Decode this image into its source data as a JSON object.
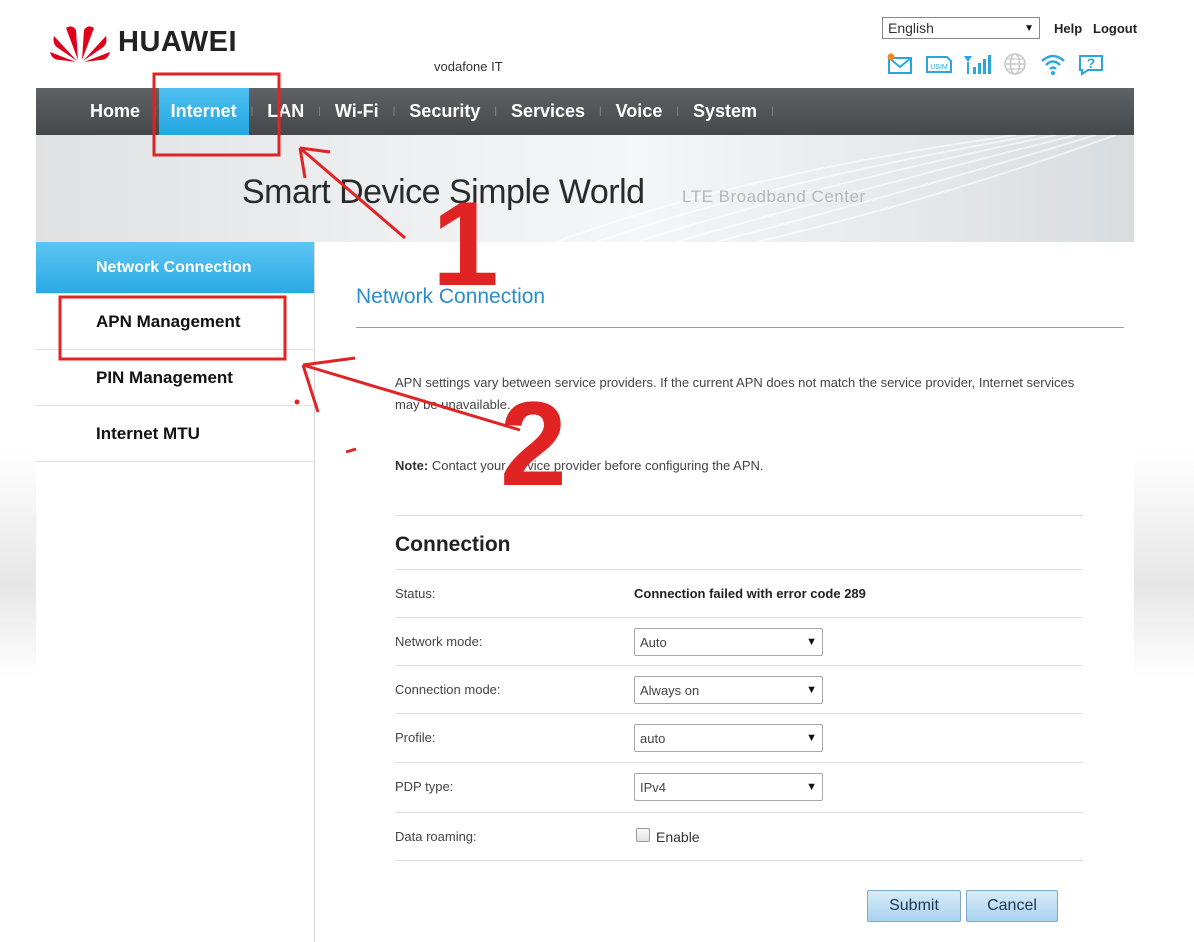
{
  "header": {
    "brand": "HUAWEI",
    "operator": "vodafone IT",
    "language": "English",
    "help": "Help",
    "logout": "Logout"
  },
  "status_icons": [
    "envelope-icon",
    "usim-icon",
    "signal-icon",
    "globe-icon",
    "wifi-icon",
    "help-icon"
  ],
  "nav": [
    "Home",
    "Internet",
    "LAN",
    "Wi-Fi",
    "Security",
    "Services",
    "Voice",
    "System"
  ],
  "nav_active": "Internet",
  "banner": {
    "slogan": "Smart Device  Simple World",
    "sub": "LTE  Broadband  Center"
  },
  "sidebar": [
    "Network Connection",
    "APN Management",
    "PIN Management",
    "Internet MTU"
  ],
  "sidebar_active": "Network Connection",
  "content": {
    "title": "Network Connection",
    "desc": "APN settings vary between service providers. If the current APN does not match the service provider, Internet services may be unavailable.",
    "note_label": "Note:",
    "note_text": " Contact your service provider before configuring the APN.",
    "section": "Connection",
    "status_label": "Status:",
    "status_value": "Connection failed with error code 289",
    "network_mode_label": "Network mode:",
    "network_mode_value": "Auto",
    "connection_mode_label": "Connection mode:",
    "connection_mode_value": "Always on",
    "profile_label": "Profile:",
    "profile_value": "auto",
    "pdp_label": "PDP type:",
    "pdp_value": "IPv4",
    "roaming_label": "Data roaming:",
    "roaming_checkbox": "Enable",
    "submit": "Submit",
    "cancel": "Cancel"
  },
  "annotations": {
    "step1": "1",
    "step2": "2",
    "highlight_color": "#e02424"
  },
  "colors": {
    "accent": "#29a8e3",
    "nav_bg": "#4f5254",
    "title": "#2a8ec9"
  }
}
